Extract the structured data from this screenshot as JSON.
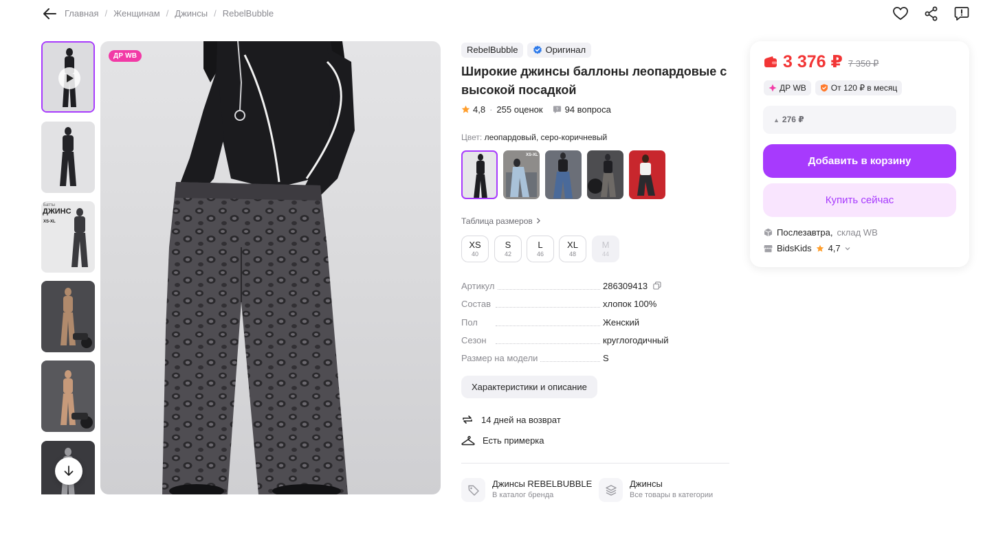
{
  "breadcrumbs": [
    "Главная",
    "Женщинам",
    "Джинсы",
    "RebelBubble"
  ],
  "gallery": {
    "badge": "ДР WB",
    "thumbnails": [
      {
        "bg": "#dcdcdf",
        "figure": "#1e1e22"
      },
      {
        "bg": "#e2e2e4",
        "figure": "#242428"
      },
      {
        "bg": "#e9e9ea",
        "figure": "#3a3a3e"
      },
      {
        "bg": "#4a4a4e",
        "figure": "#b08a6c"
      },
      {
        "bg": "#58585c",
        "figure": "#c79a7a"
      },
      {
        "bg": "#3a3a3e",
        "figure": "#9a9a9e"
      }
    ],
    "thumb_text": {
      "line1": "Батты",
      "line2": "ДЖИНС",
      "line3": "XS-XL"
    }
  },
  "product": {
    "brand": "RebelBubble",
    "original_label": "Оригинал",
    "title": "Широкие джинсы баллоны леопардовые с высокой посадкой",
    "rating": "4,8",
    "reviews": "255 оценок",
    "questions": "94 вопроса",
    "color_label": "Цвет:",
    "color_value": "леопардовый, серо-коричневый",
    "swatches": [
      {
        "bg": "#e6e6e8",
        "figure": "#1e1e22"
      },
      {
        "bg": "#8e8c8a",
        "figure": "#a9c2d9"
      },
      {
        "bg": "#6b6f78",
        "figure": "#4a6a9a"
      },
      {
        "bg": "#4d4d50",
        "figure": "#6e6a66"
      },
      {
        "bg": "#c8272d",
        "figure": "#2a2a2e"
      }
    ],
    "swatch_text": "XS-XL",
    "size_table_label": "Таблица размеров",
    "sizes": [
      {
        "label": "XS",
        "num": "40"
      },
      {
        "label": "S",
        "num": "42"
      },
      {
        "label": "L",
        "num": "46"
      },
      {
        "label": "XL",
        "num": "48"
      },
      {
        "label": "M",
        "num": "44"
      }
    ],
    "specs": [
      {
        "key": "Артикул",
        "value": "286309413"
      },
      {
        "key": "Состав",
        "value": "хлопок 100%"
      },
      {
        "key": "Пол",
        "value": "Женский"
      },
      {
        "key": "Сезон",
        "value": "круглогодичный"
      },
      {
        "key": "Размер на модели",
        "value": "S"
      }
    ],
    "characteristics_button": "Характеристики и описание",
    "features": [
      "14 дней на возврат",
      "Есть примерка"
    ],
    "category_links": [
      {
        "title": "Джинсы REBELBUBBLE",
        "subtitle": "В каталог бренда",
        "icon": "tag-icon"
      },
      {
        "title": "Джинсы",
        "subtitle": "Все товары в категории",
        "icon": "layers-icon"
      }
    ]
  },
  "price_card": {
    "price": "3 376 ₽",
    "old_price": "7 350 ₽",
    "promo_dr": "ДР WB",
    "installment": "От 120 ₽ в месяц",
    "cashback": "276 ₽",
    "add_to_cart": "Добавить в корзину",
    "buy_now": "Купить сейчас",
    "delivery_time": "Послезавтра,",
    "delivery_place": "склад WB",
    "seller_name": "BidsKids",
    "seller_rating": "4,7"
  },
  "colors": {
    "accent": "#a73afd",
    "price_red": "#f23535",
    "badge_pink": "#f23aa6",
    "star": "#ff9e2c"
  }
}
